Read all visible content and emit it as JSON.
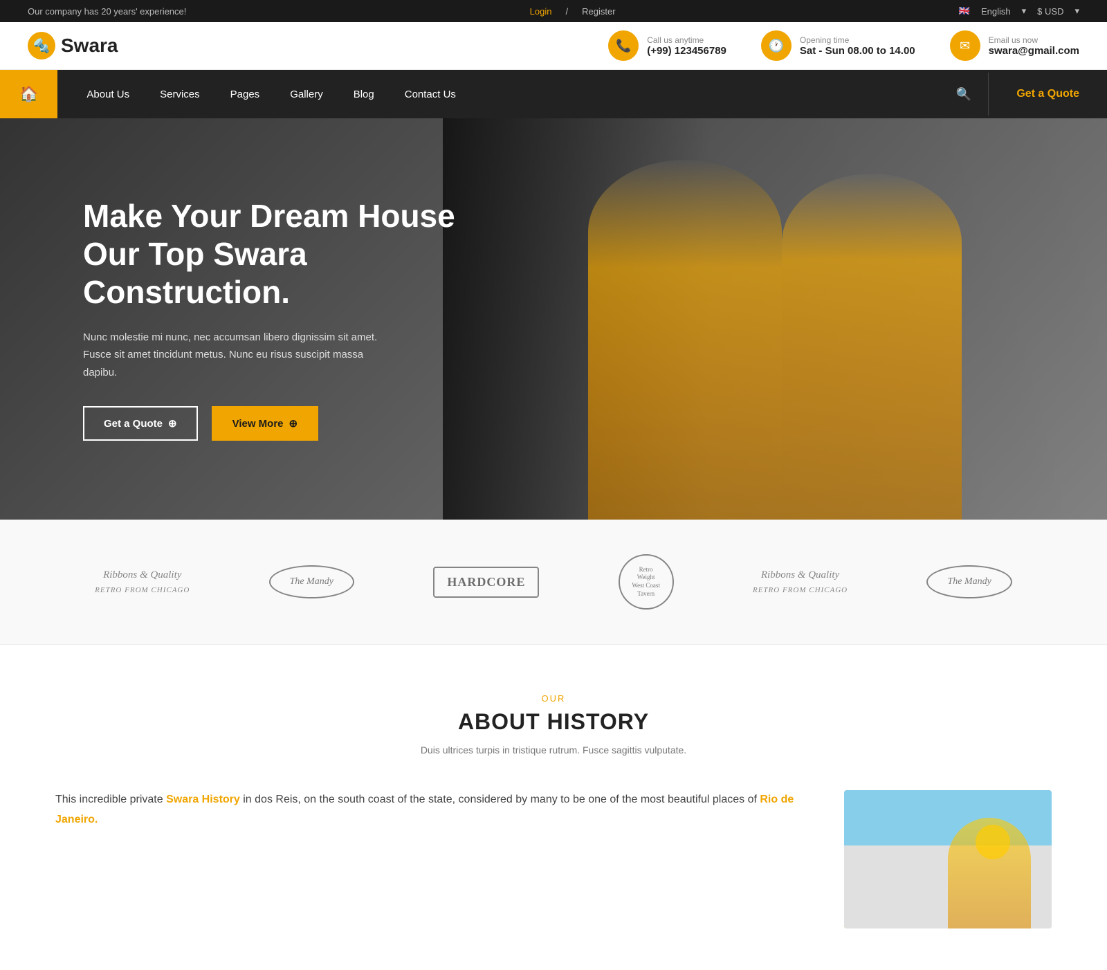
{
  "topbar": {
    "experience_text": "Our company has 20 years' experience!",
    "login_label": "Login",
    "separator": "/",
    "register_label": "Register",
    "language_label": "English",
    "currency_label": "$ USD"
  },
  "header": {
    "logo_icon": "🔩",
    "logo_name": "Swara",
    "contact": {
      "phone_label": "Call us anytime",
      "phone_number": "(+99) 123456789",
      "phone_icon": "📞",
      "hours_label": "Opening time",
      "hours_value": "Sat - Sun 08.00 to 14.00",
      "hours_icon": "🕐",
      "email_label": "Email us now",
      "email_value": "swara@gmail.com",
      "email_icon": "✉"
    }
  },
  "navbar": {
    "home_icon": "🏠",
    "links": [
      {
        "label": "About Us"
      },
      {
        "label": "Services"
      },
      {
        "label": "Pages"
      },
      {
        "label": "Gallery"
      },
      {
        "label": "Blog"
      },
      {
        "label": "Contact Us"
      }
    ],
    "cta_label": "Get a Quote"
  },
  "hero": {
    "title": "Make Your Dream House Our Top Swara Construction.",
    "description": "Nunc molestie mi nunc, nec accumsan libero dignissim sit amet. Fusce sit amet tincidunt metus. Nunc eu risus suscipit massa dapibu.",
    "btn_quote": "Get a Quote",
    "btn_more": "View More",
    "circle_icon": "⊕"
  },
  "partners": [
    {
      "type": "script",
      "text": "Ribbons & Quality\nRetro from Chicago"
    },
    {
      "type": "oval",
      "text": "The Mandy"
    },
    {
      "type": "badge",
      "text": "HARDCORE"
    },
    {
      "type": "circle",
      "text": "Retro Weight West Coast Tavern"
    },
    {
      "type": "script",
      "text": "Ribbons & Quality\nRetro from Chicago"
    },
    {
      "type": "oval",
      "text": "The Mandy"
    }
  ],
  "about": {
    "section_label": "OUR",
    "section_title": "ABOUT HISTORY",
    "section_desc": "Duis ultrices turpis in tristique rutrum. Fusce sagittis vulputate.",
    "body_text1": "This incredible private ",
    "body_link1": "Swara History",
    "body_text2": " in dos Reis, on the south coast of the state, considered by many to be one of the most beautiful places of ",
    "body_link2": "Rio de Janeiro."
  }
}
